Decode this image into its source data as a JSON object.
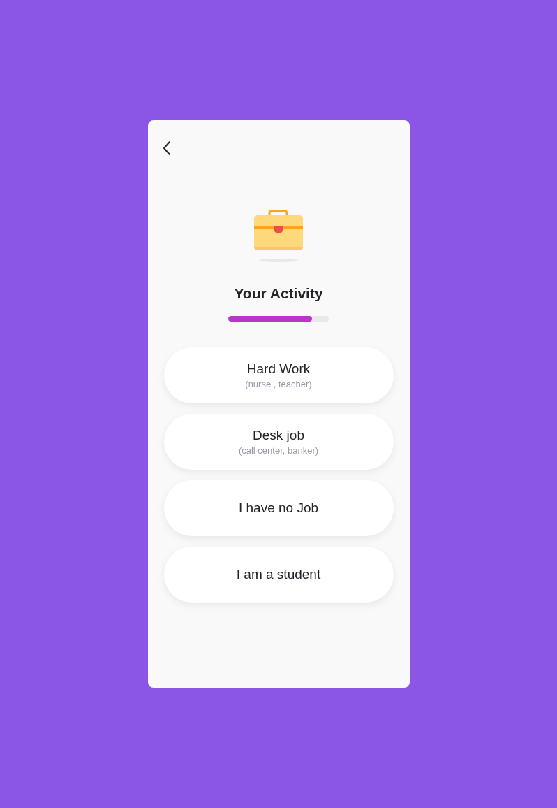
{
  "title": "Your Activity",
  "progress": {
    "level": 0.83
  },
  "options": [
    {
      "label": "Hard Work",
      "hint": "(nurse , teacher)"
    },
    {
      "label": "Desk job",
      "hint": "(call center, banker)"
    },
    {
      "label": "I have no Job"
    },
    {
      "label": "I am a student"
    }
  ]
}
